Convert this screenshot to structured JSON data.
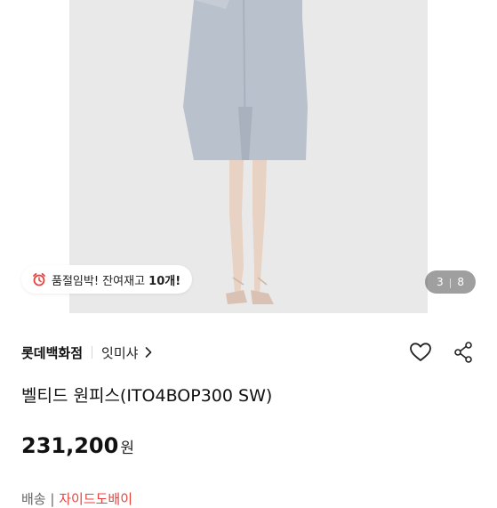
{
  "hero": {
    "stock_notice": {
      "icon": "alarm-clock-icon",
      "text_prefix": "품절임박! 잔여재고 ",
      "count": "10개!"
    },
    "pager": {
      "current": "3",
      "separator": "|",
      "total": "8"
    }
  },
  "product": {
    "store_name": "롯데백화점",
    "brand_name": "잇미샤",
    "title": "벨티드 원피스(ITO4BOP300 SW)",
    "price": "231,200",
    "currency": "원"
  },
  "next_row": {
    "label": "배송",
    "accent_text": "자이드도배이"
  },
  "colors": {
    "accent": "#e8423f",
    "photo_bg": "#e9e9ea",
    "dress": "#b7bfcc"
  }
}
